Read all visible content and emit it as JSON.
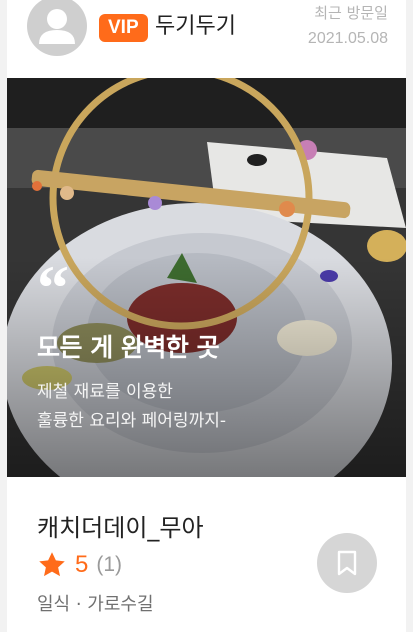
{
  "header": {
    "badge": "VIP",
    "username": "두기두기",
    "visit_label": "최근 방문일",
    "visit_date": "2021.05.08"
  },
  "hero": {
    "quote_mark": "“",
    "headline": "모든 게 완벽한 곳",
    "description_line1": "제철 재료를 이용한",
    "description_line2": "훌륭한 요리와 페어링까지-"
  },
  "restaurant": {
    "name": "캐치더데이_무아",
    "rating": "5",
    "review_count": "(1)",
    "meta": "일식 · 가로수길"
  },
  "icons": {
    "avatar": "user-avatar-icon",
    "rating": "star-icon",
    "bookmark": "bookmark-icon"
  },
  "colors": {
    "accent": "#ff6b1a",
    "avatar_bg": "#cfcfcf",
    "bookmark_bg": "#d6d6d6"
  }
}
